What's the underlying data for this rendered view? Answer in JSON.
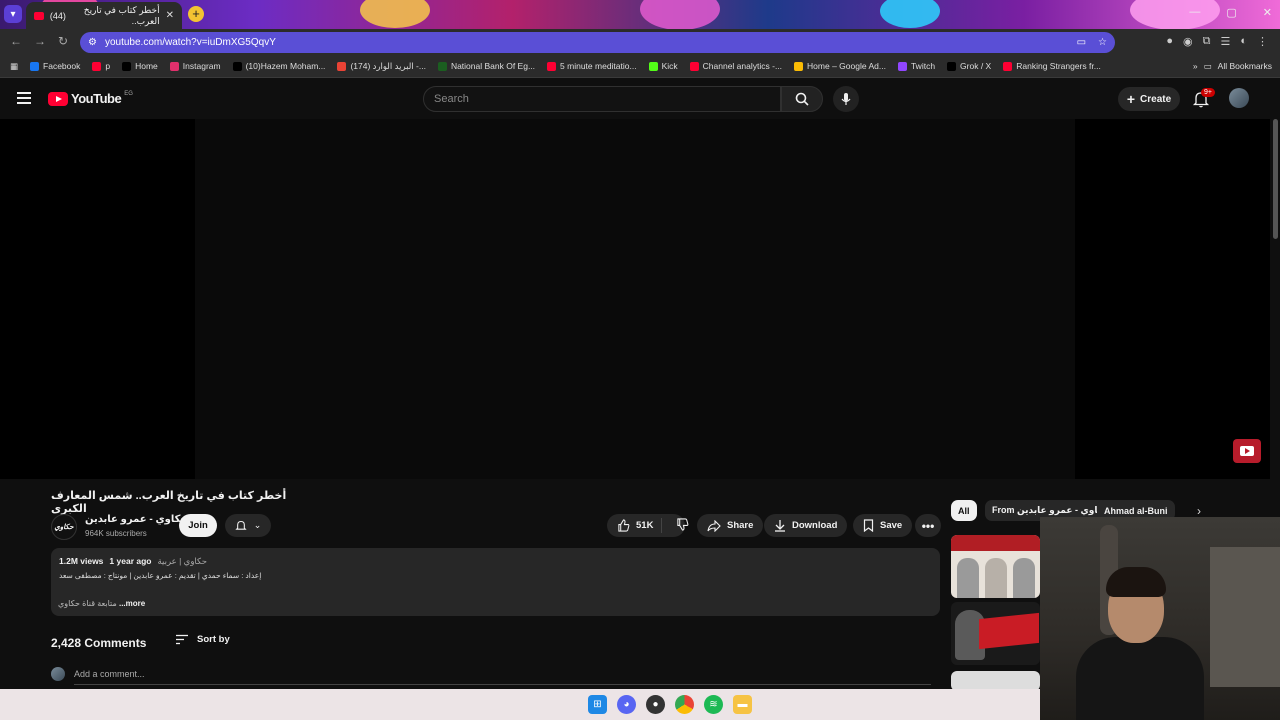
{
  "browser": {
    "tab_title": "أخطر كتاب في تاريخ العرب..",
    "tab_count_prefix": "(44)",
    "url": "youtube.com/watch?v=iuDmXG5QqvY",
    "bookmarks": [
      {
        "label": "Facebook",
        "color": "#1877f2"
      },
      {
        "label": "p",
        "color": "#ff0033"
      },
      {
        "label": "Home",
        "color": "#000000"
      },
      {
        "label": "Instagram",
        "color": "#e1306c"
      },
      {
        "label": "(10)Hazem Moham...",
        "color": "#000000"
      },
      {
        "label": "(174) البريد الوارد -...",
        "color": "#ea4335"
      },
      {
        "label": "National Bank Of Eg...",
        "color": "#1b5e20"
      },
      {
        "label": "5 minute meditatio...",
        "color": "#ff0033"
      },
      {
        "label": "Kick",
        "color": "#53fc18"
      },
      {
        "label": "Channel analytics -...",
        "color": "#ff0033"
      },
      {
        "label": "Home – Google Ad...",
        "color": "#fbbc04"
      },
      {
        "label": "Twitch",
        "color": "#9146ff"
      },
      {
        "label": "Grok / X",
        "color": "#000000"
      },
      {
        "label": "Ranking Strangers fr...",
        "color": "#ff0033"
      }
    ],
    "all_bookmarks": "All Bookmarks"
  },
  "youtube": {
    "logo_text": "YouTube",
    "logo_country": "EG",
    "search_placeholder": "Search",
    "create_label": "Create",
    "notification_count": "9+"
  },
  "video": {
    "title": "أخطر كتاب في تاريخ العرب.. شمس المعارف الكبرى",
    "channel_name": "حكاوي - عمرو عابدين",
    "channel_logo_text": "حكاوي",
    "subscribers": "964K subscribers",
    "join_label": "Join",
    "likes": "51K",
    "share_label": "Share",
    "download_label": "Download",
    "save_label": "Save"
  },
  "description": {
    "views": "1.2M views",
    "age": "1 year ago",
    "tags": "حكاوي | عربية",
    "credits": "إعداد : سماء حمدي | تقديم : عمرو عابدين | مونتاج : مصطفى سعد",
    "snippet": "متابعة قناة حكاوي",
    "more_label": "...more"
  },
  "comments": {
    "count": "2,428 Comments",
    "sort_label": "Sort by",
    "add_placeholder": "Add a comment..."
  },
  "chips": [
    "All",
    "From حكاوي - عمرو عابدين",
    "Ahmad al-Buni"
  ]
}
